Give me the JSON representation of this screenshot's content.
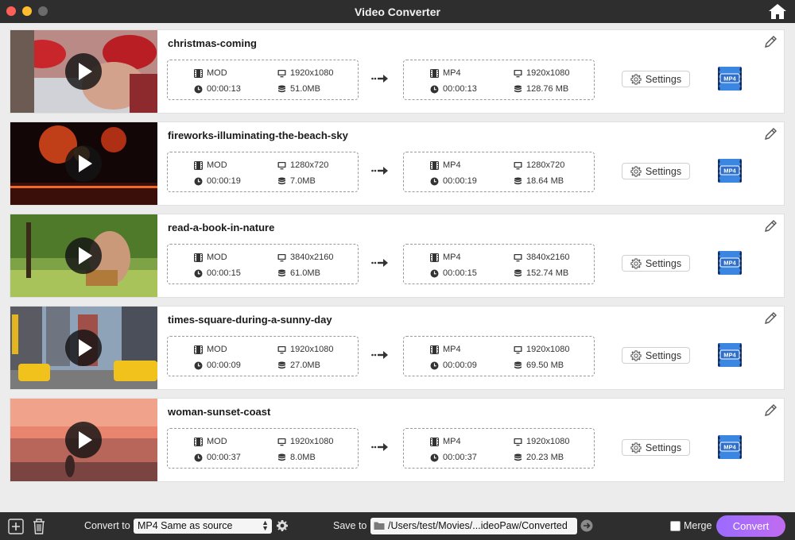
{
  "window": {
    "title": "Video Converter"
  },
  "icons": {
    "home": "home-icon",
    "edit": "pencil-icon",
    "format": "video-icon",
    "resolution": "monitor-icon",
    "duration": "clock-icon",
    "size": "database-icon",
    "settings": "gear-icon",
    "arrow": "right-arrow-icon",
    "add": "add-file-icon",
    "delete": "trash-icon",
    "folder": "folder-icon",
    "go": "arrow-circle-icon"
  },
  "colors": {
    "convert_gradient_start": "#9b6bff",
    "convert_gradient_end": "#c06cf0",
    "titlebar": "#2e2e2e",
    "mp4_badge": "#2f6fc9"
  },
  "files": [
    {
      "name": "christmas-coming",
      "source": {
        "format": "MOD",
        "resolution": "1920x1080",
        "duration": "00:00:13",
        "size": "51.0MB"
      },
      "output": {
        "format": "MP4",
        "resolution": "1920x1080",
        "duration": "00:00:13",
        "size": "128.76 MB"
      },
      "settings_label": "Settings",
      "output_badge": "MP4"
    },
    {
      "name": "fireworks-illuminating-the-beach-sky",
      "source": {
        "format": "MOD",
        "resolution": "1280x720",
        "duration": "00:00:19",
        "size": "7.0MB"
      },
      "output": {
        "format": "MP4",
        "resolution": "1280x720",
        "duration": "00:00:19",
        "size": "18.64 MB"
      },
      "settings_label": "Settings",
      "output_badge": "MP4"
    },
    {
      "name": "read-a-book-in-nature",
      "source": {
        "format": "MOD",
        "resolution": "3840x2160",
        "duration": "00:00:15",
        "size": "61.0MB"
      },
      "output": {
        "format": "MP4",
        "resolution": "3840x2160",
        "duration": "00:00:15",
        "size": "152.74 MB"
      },
      "settings_label": "Settings",
      "output_badge": "MP4"
    },
    {
      "name": "times-square-during-a-sunny-day",
      "source": {
        "format": "MOD",
        "resolution": "1920x1080",
        "duration": "00:00:09",
        "size": "27.0MB"
      },
      "output": {
        "format": "MP4",
        "resolution": "1920x1080",
        "duration": "00:00:09",
        "size": "69.50 MB"
      },
      "settings_label": "Settings",
      "output_badge": "MP4"
    },
    {
      "name": "woman-sunset-coast",
      "source": {
        "format": "MOD",
        "resolution": "1920x1080",
        "duration": "00:00:37",
        "size": "8.0MB"
      },
      "output": {
        "format": "MP4",
        "resolution": "1920x1080",
        "duration": "00:00:37",
        "size": "20.23 MB"
      },
      "settings_label": "Settings",
      "output_badge": "MP4"
    }
  ],
  "bottom_bar": {
    "convert_to_label": "Convert to",
    "convert_to_value": "MP4 Same as source",
    "save_to_label": "Save to",
    "save_to_path": "/Users/test/Movies/...ideoPaw/Converted",
    "merge_label": "Merge",
    "merge_checked": false,
    "convert_button": "Convert"
  }
}
